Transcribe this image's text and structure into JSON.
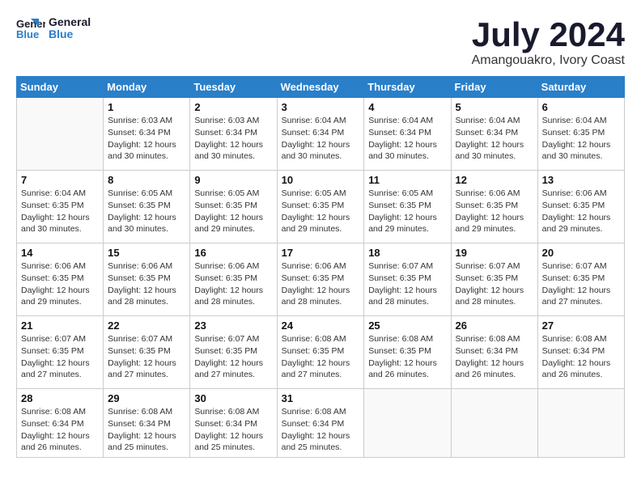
{
  "logo": {
    "line1": "General",
    "line2": "Blue"
  },
  "title": "July 2024",
  "location": "Amangouakro, Ivory Coast",
  "days_of_week": [
    "Sunday",
    "Monday",
    "Tuesday",
    "Wednesday",
    "Thursday",
    "Friday",
    "Saturday"
  ],
  "weeks": [
    [
      {
        "day": "",
        "sunrise": "",
        "sunset": "",
        "daylight": ""
      },
      {
        "day": "1",
        "sunrise": "Sunrise: 6:03 AM",
        "sunset": "Sunset: 6:34 PM",
        "daylight": "Daylight: 12 hours and 30 minutes."
      },
      {
        "day": "2",
        "sunrise": "Sunrise: 6:03 AM",
        "sunset": "Sunset: 6:34 PM",
        "daylight": "Daylight: 12 hours and 30 minutes."
      },
      {
        "day": "3",
        "sunrise": "Sunrise: 6:04 AM",
        "sunset": "Sunset: 6:34 PM",
        "daylight": "Daylight: 12 hours and 30 minutes."
      },
      {
        "day": "4",
        "sunrise": "Sunrise: 6:04 AM",
        "sunset": "Sunset: 6:34 PM",
        "daylight": "Daylight: 12 hours and 30 minutes."
      },
      {
        "day": "5",
        "sunrise": "Sunrise: 6:04 AM",
        "sunset": "Sunset: 6:34 PM",
        "daylight": "Daylight: 12 hours and 30 minutes."
      },
      {
        "day": "6",
        "sunrise": "Sunrise: 6:04 AM",
        "sunset": "Sunset: 6:35 PM",
        "daylight": "Daylight: 12 hours and 30 minutes."
      }
    ],
    [
      {
        "day": "7",
        "sunrise": "Sunrise: 6:04 AM",
        "sunset": "Sunset: 6:35 PM",
        "daylight": "Daylight: 12 hours and 30 minutes."
      },
      {
        "day": "8",
        "sunrise": "Sunrise: 6:05 AM",
        "sunset": "Sunset: 6:35 PM",
        "daylight": "Daylight: 12 hours and 30 minutes."
      },
      {
        "day": "9",
        "sunrise": "Sunrise: 6:05 AM",
        "sunset": "Sunset: 6:35 PM",
        "daylight": "Daylight: 12 hours and 29 minutes."
      },
      {
        "day": "10",
        "sunrise": "Sunrise: 6:05 AM",
        "sunset": "Sunset: 6:35 PM",
        "daylight": "Daylight: 12 hours and 29 minutes."
      },
      {
        "day": "11",
        "sunrise": "Sunrise: 6:05 AM",
        "sunset": "Sunset: 6:35 PM",
        "daylight": "Daylight: 12 hours and 29 minutes."
      },
      {
        "day": "12",
        "sunrise": "Sunrise: 6:06 AM",
        "sunset": "Sunset: 6:35 PM",
        "daylight": "Daylight: 12 hours and 29 minutes."
      },
      {
        "day": "13",
        "sunrise": "Sunrise: 6:06 AM",
        "sunset": "Sunset: 6:35 PM",
        "daylight": "Daylight: 12 hours and 29 minutes."
      }
    ],
    [
      {
        "day": "14",
        "sunrise": "Sunrise: 6:06 AM",
        "sunset": "Sunset: 6:35 PM",
        "daylight": "Daylight: 12 hours and 29 minutes."
      },
      {
        "day": "15",
        "sunrise": "Sunrise: 6:06 AM",
        "sunset": "Sunset: 6:35 PM",
        "daylight": "Daylight: 12 hours and 28 minutes."
      },
      {
        "day": "16",
        "sunrise": "Sunrise: 6:06 AM",
        "sunset": "Sunset: 6:35 PM",
        "daylight": "Daylight: 12 hours and 28 minutes."
      },
      {
        "day": "17",
        "sunrise": "Sunrise: 6:06 AM",
        "sunset": "Sunset: 6:35 PM",
        "daylight": "Daylight: 12 hours and 28 minutes."
      },
      {
        "day": "18",
        "sunrise": "Sunrise: 6:07 AM",
        "sunset": "Sunset: 6:35 PM",
        "daylight": "Daylight: 12 hours and 28 minutes."
      },
      {
        "day": "19",
        "sunrise": "Sunrise: 6:07 AM",
        "sunset": "Sunset: 6:35 PM",
        "daylight": "Daylight: 12 hours and 28 minutes."
      },
      {
        "day": "20",
        "sunrise": "Sunrise: 6:07 AM",
        "sunset": "Sunset: 6:35 PM",
        "daylight": "Daylight: 12 hours and 27 minutes."
      }
    ],
    [
      {
        "day": "21",
        "sunrise": "Sunrise: 6:07 AM",
        "sunset": "Sunset: 6:35 PM",
        "daylight": "Daylight: 12 hours and 27 minutes."
      },
      {
        "day": "22",
        "sunrise": "Sunrise: 6:07 AM",
        "sunset": "Sunset: 6:35 PM",
        "daylight": "Daylight: 12 hours and 27 minutes."
      },
      {
        "day": "23",
        "sunrise": "Sunrise: 6:07 AM",
        "sunset": "Sunset: 6:35 PM",
        "daylight": "Daylight: 12 hours and 27 minutes."
      },
      {
        "day": "24",
        "sunrise": "Sunrise: 6:08 AM",
        "sunset": "Sunset: 6:35 PM",
        "daylight": "Daylight: 12 hours and 27 minutes."
      },
      {
        "day": "25",
        "sunrise": "Sunrise: 6:08 AM",
        "sunset": "Sunset: 6:35 PM",
        "daylight": "Daylight: 12 hours and 26 minutes."
      },
      {
        "day": "26",
        "sunrise": "Sunrise: 6:08 AM",
        "sunset": "Sunset: 6:34 PM",
        "daylight": "Daylight: 12 hours and 26 minutes."
      },
      {
        "day": "27",
        "sunrise": "Sunrise: 6:08 AM",
        "sunset": "Sunset: 6:34 PM",
        "daylight": "Daylight: 12 hours and 26 minutes."
      }
    ],
    [
      {
        "day": "28",
        "sunrise": "Sunrise: 6:08 AM",
        "sunset": "Sunset: 6:34 PM",
        "daylight": "Daylight: 12 hours and 26 minutes."
      },
      {
        "day": "29",
        "sunrise": "Sunrise: 6:08 AM",
        "sunset": "Sunset: 6:34 PM",
        "daylight": "Daylight: 12 hours and 25 minutes."
      },
      {
        "day": "30",
        "sunrise": "Sunrise: 6:08 AM",
        "sunset": "Sunset: 6:34 PM",
        "daylight": "Daylight: 12 hours and 25 minutes."
      },
      {
        "day": "31",
        "sunrise": "Sunrise: 6:08 AM",
        "sunset": "Sunset: 6:34 PM",
        "daylight": "Daylight: 12 hours and 25 minutes."
      },
      {
        "day": "",
        "sunrise": "",
        "sunset": "",
        "daylight": ""
      },
      {
        "day": "",
        "sunrise": "",
        "sunset": "",
        "daylight": ""
      },
      {
        "day": "",
        "sunrise": "",
        "sunset": "",
        "daylight": ""
      }
    ]
  ]
}
